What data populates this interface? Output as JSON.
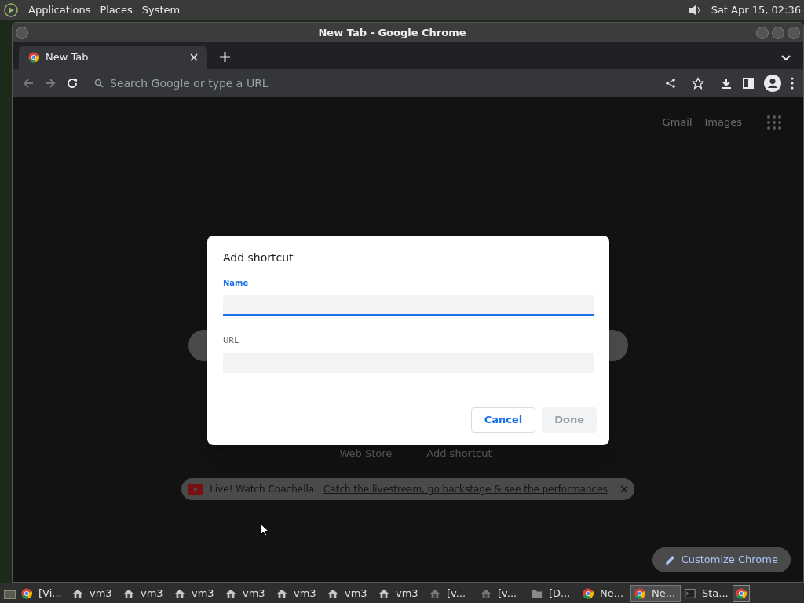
{
  "top_panel": {
    "menus": [
      "Applications",
      "Places",
      "System"
    ],
    "clock": "Sat Apr 15, 02:36"
  },
  "window": {
    "title": "New Tab - Google Chrome"
  },
  "tabs": [
    {
      "label": "New Tab",
      "selected": true
    }
  ],
  "omnibox": {
    "placeholder": "Search Google or type a URL"
  },
  "ntp": {
    "links": [
      "Gmail",
      "Images"
    ],
    "shortcuts": [
      "Web Store",
      "Add shortcut"
    ],
    "promo": {
      "text": "Live! Watch Coachella.",
      "link": "Catch the livestream, go backstage & see the performances"
    },
    "customize": "Customize Chrome"
  },
  "dialog": {
    "title": "Add shortcut",
    "fields": [
      {
        "label": "Name",
        "focused": true
      },
      {
        "label": "URL",
        "focused": false
      }
    ],
    "buttons": [
      {
        "label": "Cancel",
        "disabled": false
      },
      {
        "label": "Done",
        "disabled": true
      }
    ]
  },
  "taskbar": [
    {
      "kind": "chrome",
      "label": "[Vi...",
      "selected": false
    },
    {
      "kind": "house",
      "label": "vm3",
      "selected": false
    },
    {
      "kind": "house",
      "label": "vm3",
      "selected": false
    },
    {
      "kind": "house",
      "label": "vm3",
      "selected": false
    },
    {
      "kind": "house",
      "label": "vm3",
      "selected": false
    },
    {
      "kind": "house",
      "label": "vm3",
      "selected": false
    },
    {
      "kind": "house",
      "label": "vm3",
      "selected": false
    },
    {
      "kind": "house",
      "label": "vm3",
      "selected": false
    },
    {
      "kind": "house-dim",
      "label": "[v...",
      "selected": false
    },
    {
      "kind": "house-dim",
      "label": "[v...",
      "selected": false
    },
    {
      "kind": "folder",
      "label": "[D...",
      "selected": false
    },
    {
      "kind": "chrome",
      "label": "Ne...",
      "selected": false
    },
    {
      "kind": "chrome",
      "label": "Ne...",
      "selected": true
    },
    {
      "kind": "terminal",
      "label": "Sta...",
      "selected": false
    }
  ]
}
